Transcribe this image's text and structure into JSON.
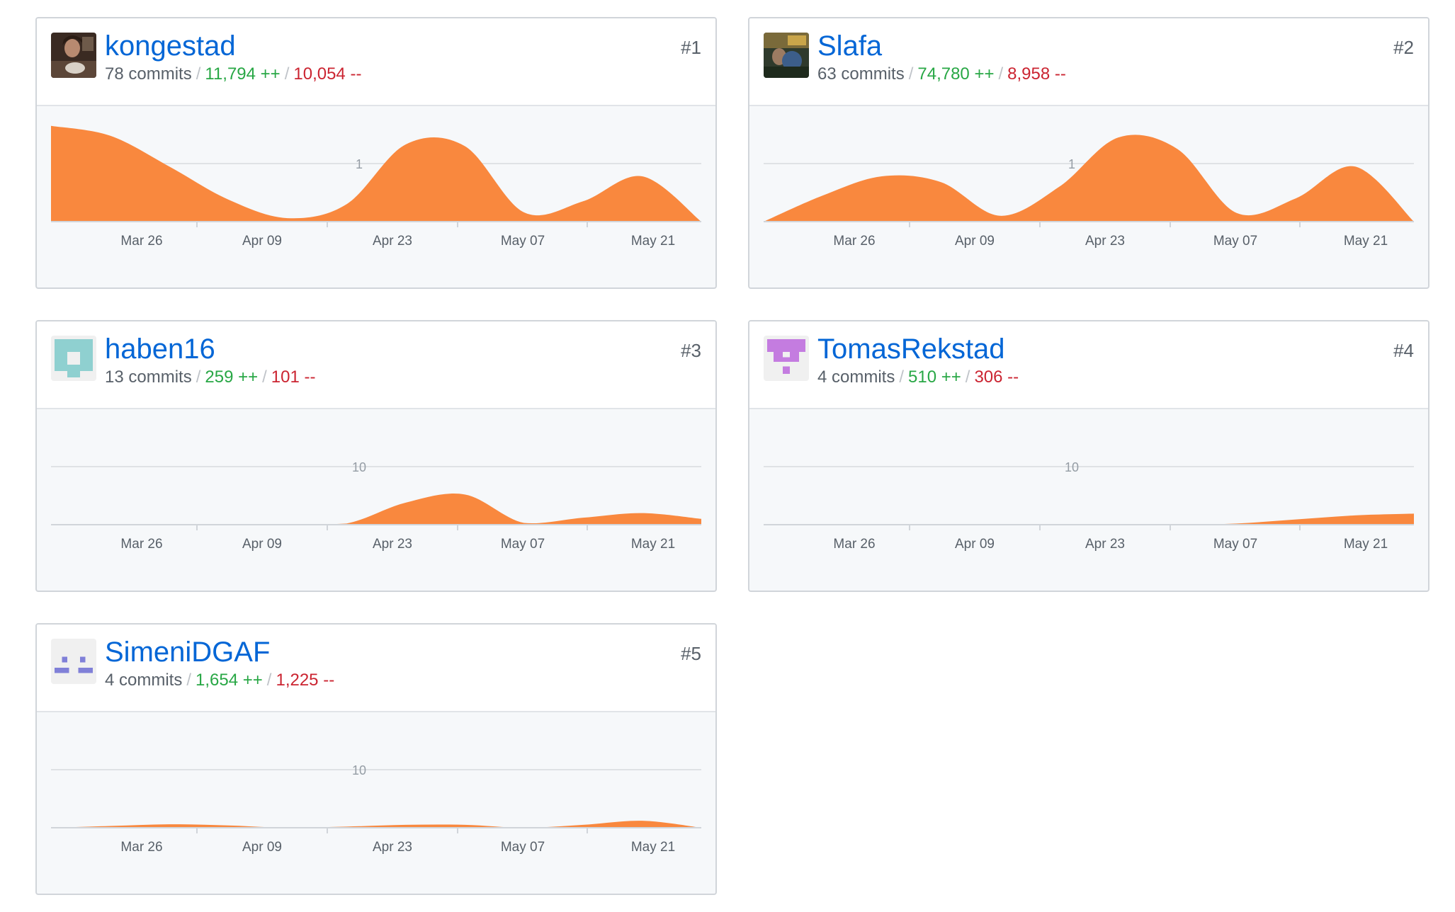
{
  "colors": {
    "link": "#0366d6",
    "additions": "#28a745",
    "deletions": "#cb2431",
    "area_fill": "#f9883e",
    "grid": "#dfe2e5",
    "axis": "#d1d5da",
    "tick_text": "#586069"
  },
  "axis_ticks": [
    "Mar 26",
    "Apr 09",
    "Apr 23",
    "May 07",
    "May 21"
  ],
  "contributors": [
    {
      "username": "kongestad",
      "commits": "78 commits",
      "additions": "11,794 ++",
      "deletions": "10,054 --",
      "rank": "#1",
      "avatar": "photo-avatar",
      "gridline_label": "1"
    },
    {
      "username": "Slafa",
      "commits": "63 commits",
      "additions": "74,780 ++",
      "deletions": "8,958 --",
      "rank": "#2",
      "avatar": "photo-avatar",
      "gridline_label": "1"
    },
    {
      "username": "haben16",
      "commits": "13 commits",
      "additions": "259 ++",
      "deletions": "101 --",
      "rank": "#3",
      "avatar": "identicon-teal",
      "gridline_label": "10"
    },
    {
      "username": "TomasRekstad",
      "commits": "4 commits",
      "additions": "510 ++",
      "deletions": "306 --",
      "rank": "#4",
      "avatar": "identicon-purple",
      "gridline_label": "10"
    },
    {
      "username": "SimeniDGAF",
      "commits": "4 commits",
      "additions": "1,654 ++",
      "deletions": "1,225 --",
      "rank": "#5",
      "avatar": "identicon-indigo",
      "gridline_label": "10"
    }
  ],
  "chart_data": [
    {
      "type": "area",
      "contributor": "kongestad",
      "x": [
        "Mar 12",
        "Mar 19",
        "Mar 26",
        "Apr 02",
        "Apr 09",
        "Apr 16",
        "Apr 23",
        "Apr 30",
        "May 07",
        "May 14",
        "May 21",
        "May 28"
      ],
      "y": [
        16.5,
        14.8,
        9.5,
        3.8,
        0.6,
        3.0,
        13.3,
        13.0,
        1.6,
        3.5,
        7.8,
        0
      ],
      "ylim": [
        0,
        20
      ],
      "gridlines": [
        10
      ]
    },
    {
      "type": "area",
      "contributor": "Slafa",
      "x": [
        "Mar 12",
        "Mar 19",
        "Mar 26",
        "Apr 02",
        "Apr 09",
        "Apr 16",
        "Apr 23",
        "Apr 30",
        "May 07",
        "May 14",
        "May 21",
        "May 28"
      ],
      "y": [
        0,
        4.5,
        7.8,
        6.8,
        1.0,
        6.0,
        14.5,
        12.5,
        1.5,
        4.0,
        9.5,
        0
      ],
      "ylim": [
        0,
        20
      ],
      "gridlines": [
        10
      ]
    },
    {
      "type": "area",
      "contributor": "haben16",
      "x": [
        "Mar 12",
        "Mar 19",
        "Mar 26",
        "Apr 02",
        "Apr 09",
        "Apr 16",
        "Apr 23",
        "Apr 30",
        "May 07",
        "May 14",
        "May 21",
        "May 28"
      ],
      "y": [
        0,
        0,
        0,
        0,
        0,
        0.2,
        3.8,
        5.2,
        0.3,
        1.2,
        2.0,
        1.0
      ],
      "ylim": [
        0,
        20
      ],
      "gridlines": [
        10
      ]
    },
    {
      "type": "area",
      "contributor": "TomasRekstad",
      "x": [
        "Mar 12",
        "Mar 19",
        "Mar 26",
        "Apr 02",
        "Apr 09",
        "Apr 16",
        "Apr 23",
        "Apr 30",
        "May 07",
        "May 14",
        "May 21",
        "May 28"
      ],
      "y": [
        0,
        0,
        0,
        0,
        0,
        0,
        0,
        0,
        0.2,
        0.9,
        1.6,
        1.9
      ],
      "ylim": [
        0,
        20
      ],
      "gridlines": [
        10
      ]
    },
    {
      "type": "area",
      "contributor": "SimeniDGAF",
      "x": [
        "Mar 12",
        "Mar 19",
        "Mar 26",
        "Apr 02",
        "Apr 09",
        "Apr 16",
        "Apr 23",
        "Apr 30",
        "May 07",
        "May 14",
        "May 21",
        "May 28"
      ],
      "y": [
        0,
        0.3,
        0.6,
        0.4,
        0,
        0.2,
        0.5,
        0.5,
        0,
        0.5,
        1.2,
        0
      ],
      "ylim": [
        0,
        20
      ],
      "gridlines": [
        10
      ]
    }
  ]
}
